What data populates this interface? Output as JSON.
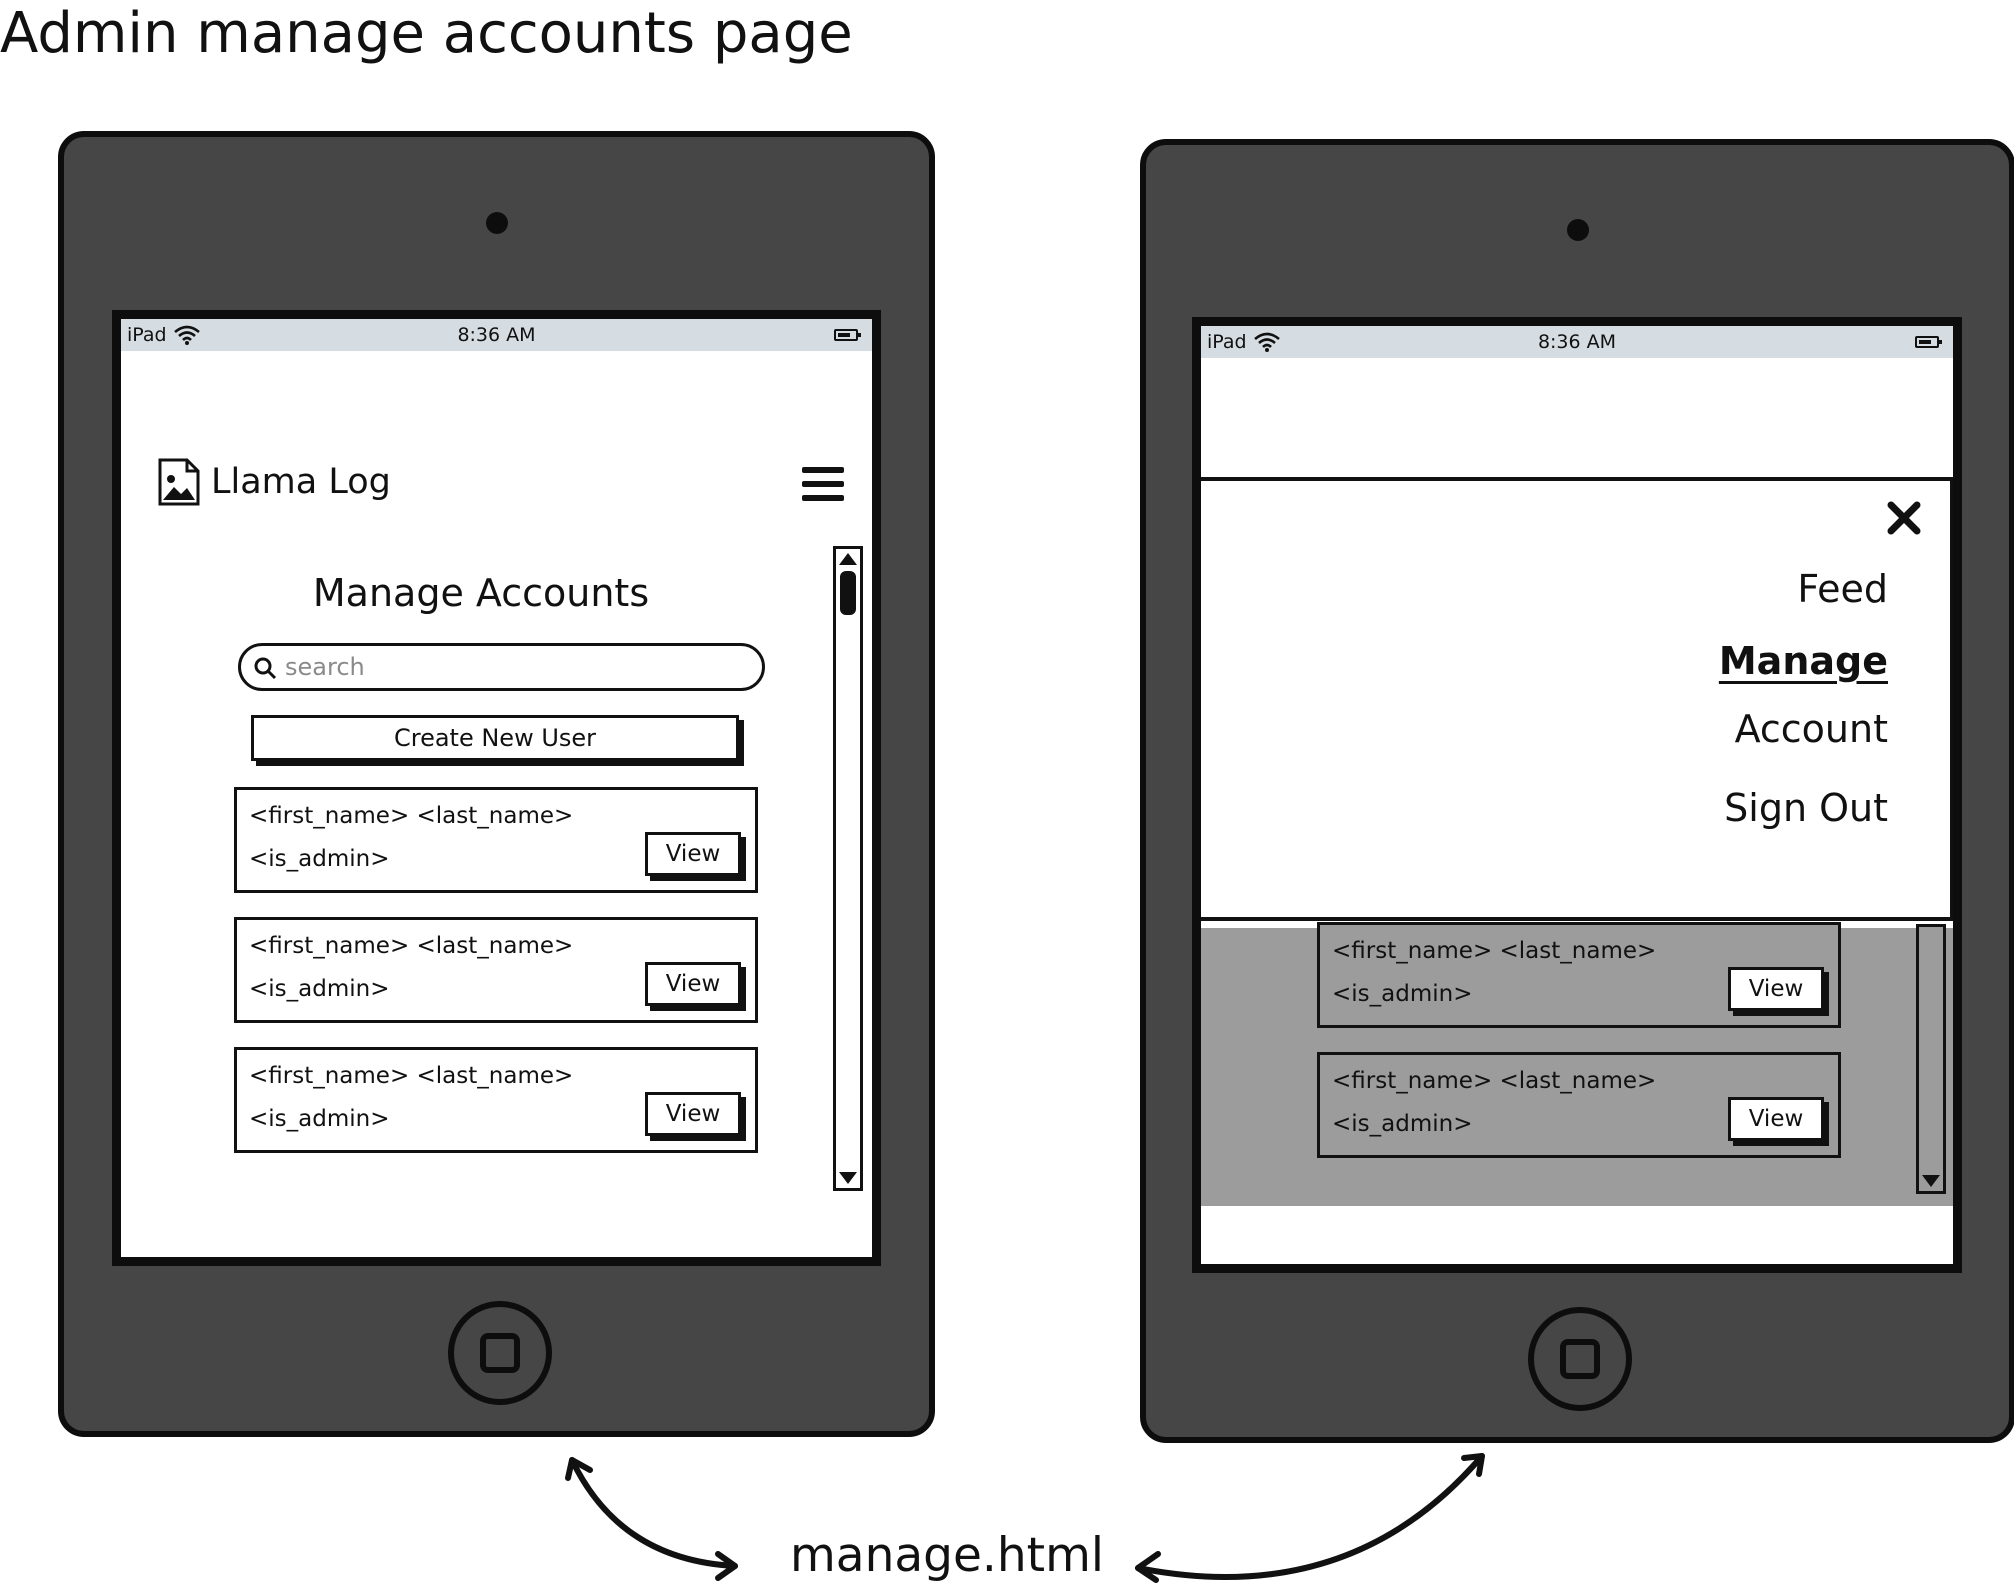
{
  "page_title": "Admin manage accounts page",
  "caption": "manage.html",
  "status_bar": {
    "device": "iPad",
    "time": "8:36 AM"
  },
  "app": {
    "name": "Llama Log"
  },
  "main": {
    "heading": "Manage Accounts",
    "search_placeholder": "search",
    "create_button": "Create New User",
    "accounts": [
      {
        "name": "<first_name> <last_name>",
        "role": "<is_admin>",
        "action": "View"
      },
      {
        "name": "<first_name> <last_name>",
        "role": "<is_admin>",
        "action": "View"
      },
      {
        "name": "<first_name> <last_name>",
        "role": "<is_admin>",
        "action": "View"
      }
    ]
  },
  "nav_menu": {
    "items": [
      {
        "label": "Feed",
        "active": false
      },
      {
        "label": "Manage",
        "active": true
      },
      {
        "label": "Account",
        "active": false
      },
      {
        "label": "Sign Out",
        "active": false
      }
    ]
  },
  "colors": {
    "ipad_body": "#464646",
    "status_bar": "#d6dde2",
    "overlay_dim": "#9c9c9c",
    "ink": "#111111"
  },
  "icons": {
    "logo": "image-file-icon",
    "menu": "hamburger-menu-icon",
    "search": "magnifier-search-icon",
    "close": "close-x-icon",
    "wifi": "wifi-icon",
    "battery": "battery-icon"
  }
}
